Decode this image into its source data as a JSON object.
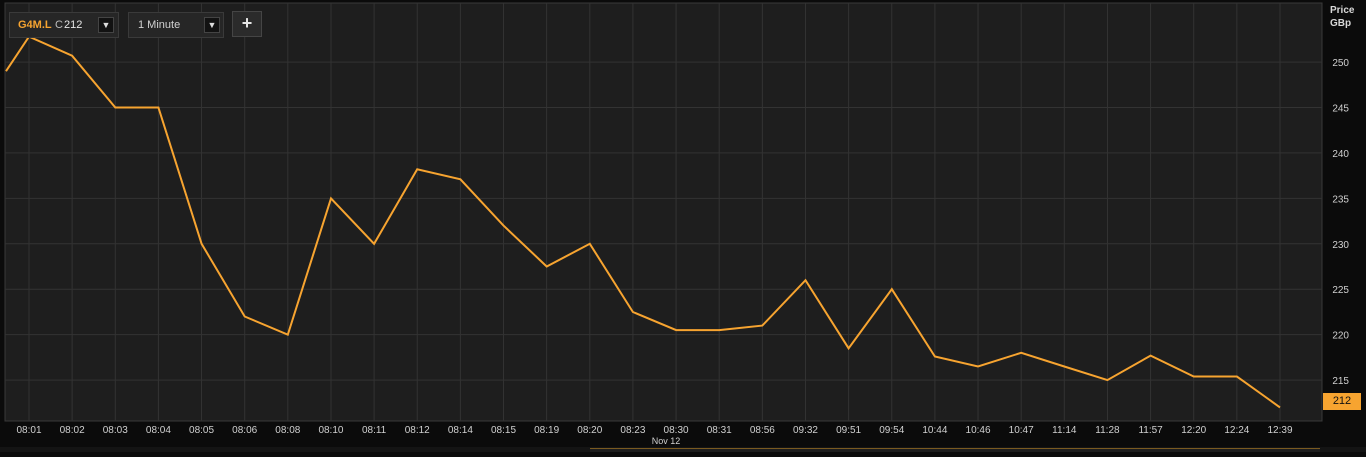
{
  "toolbar": {
    "symbol": "G4M.L",
    "close_label": "C",
    "close_value": "212",
    "interval": "1 Minute",
    "add_button": "+",
    "dropdown_icon": "▼"
  },
  "price_axis": {
    "title": "Price",
    "unit": "GBp",
    "ticks": [
      "250",
      "245",
      "240",
      "235",
      "230",
      "225",
      "220",
      "215"
    ]
  },
  "last_price": "212",
  "colors": {
    "line": "#f7a430",
    "background": "#1e1e1e",
    "grid": "#333333",
    "accent": "#f7a430"
  },
  "chart_data": {
    "type": "line",
    "x_date_label": "Nov 12",
    "categories": [
      "08:01",
      "08:02",
      "08:03",
      "08:04",
      "08:05",
      "08:06",
      "08:08",
      "08:10",
      "08:11",
      "08:12",
      "08:14",
      "08:15",
      "08:19",
      "08:20",
      "08:23",
      "08:30",
      "08:31",
      "08:56",
      "09:32",
      "09:51",
      "09:54",
      "10:44",
      "10:46",
      "10:47",
      "11:14",
      "11:28",
      "11:57",
      "12:20",
      "12:24",
      "12:39"
    ],
    "series": [
      {
        "values": [
          252.8,
          250.7,
          245.0,
          245.0,
          230.0,
          222.0,
          220.0,
          235.0,
          230.0,
          238.2,
          237.1,
          232.0,
          227.5,
          230.0,
          222.5,
          220.5,
          220.5,
          221.0,
          226.0,
          218.5,
          225.0,
          217.6,
          216.5,
          218.0,
          216.5,
          215.0,
          217.7,
          215.4,
          215.4,
          212.0
        ]
      }
    ],
    "start_value": 249.0,
    "ylim": [
      210.5,
      256.5
    ],
    "yticks": [
      250,
      245,
      240,
      235,
      230,
      225,
      220,
      215
    ],
    "grid": true,
    "legend": "none"
  }
}
